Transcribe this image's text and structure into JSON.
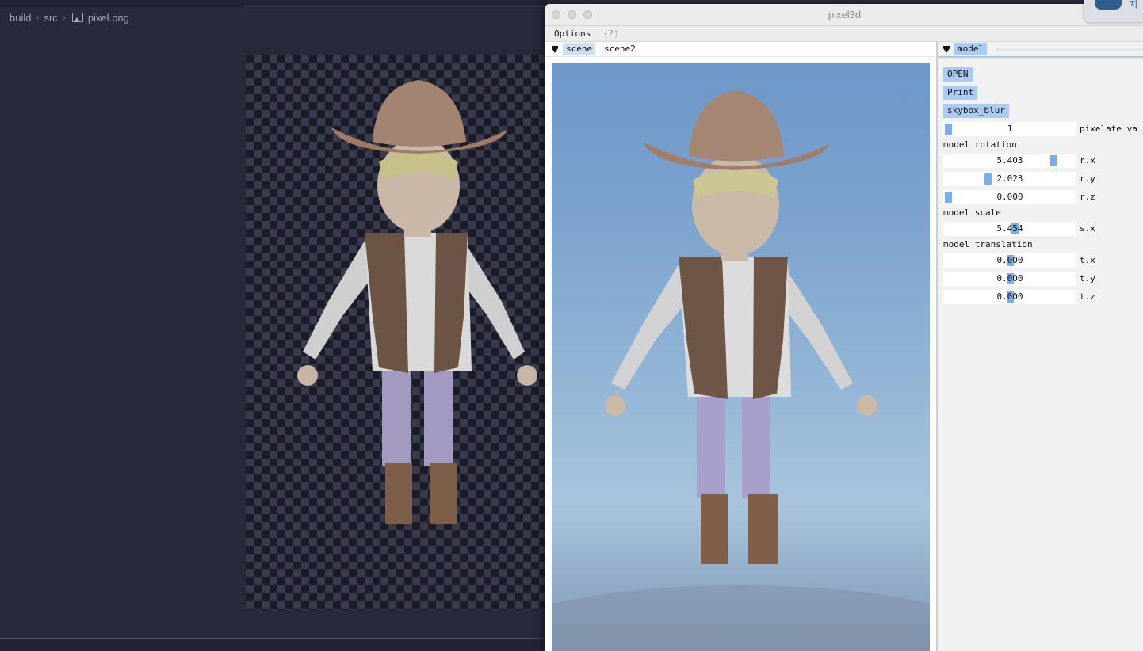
{
  "editor": {
    "breadcrumb": [
      "build",
      "src",
      "pixel.png"
    ],
    "preview_file": "pixel.png"
  },
  "window": {
    "title": "pixel3d",
    "menu": {
      "options": "Options",
      "help": "(?)"
    }
  },
  "scene_panel": {
    "tabs": [
      {
        "label": "scene",
        "active": true
      },
      {
        "label": "scene2",
        "active": false
      }
    ]
  },
  "model_panel": {
    "tab": "model",
    "buttons": {
      "open": "OPEN",
      "print": "Print",
      "skybox": "skybox_blur"
    },
    "pixelate": {
      "value": "1",
      "label": "pixelate va",
      "level": 0.0
    },
    "rotation": {
      "title": "model rotation",
      "rx": {
        "value": "5.403",
        "label": "r.x",
        "level": 0.86
      },
      "ry": {
        "value": "2.023",
        "label": "r.y",
        "level": 0.32
      },
      "rz": {
        "value": "0.000",
        "label": "r.z",
        "level": 0.0
      }
    },
    "scale": {
      "title": "model scale",
      "sx": {
        "value": "5.454",
        "label": "s.x",
        "level": 0.54
      }
    },
    "translation": {
      "title": "model translation",
      "tx": {
        "value": "0.000",
        "label": "t.x",
        "level": 0.5
      },
      "ty": {
        "value": "0.000",
        "label": "t.y",
        "level": 0.5
      },
      "tz": {
        "value": "0.000",
        "label": "t.z",
        "level": 0.5
      }
    }
  },
  "colors": {
    "accent": "#a9cbef",
    "slider_grab": "#79aeea",
    "editor_bg": "#272a3b"
  },
  "corner_widget": {
    "text": "지"
  }
}
